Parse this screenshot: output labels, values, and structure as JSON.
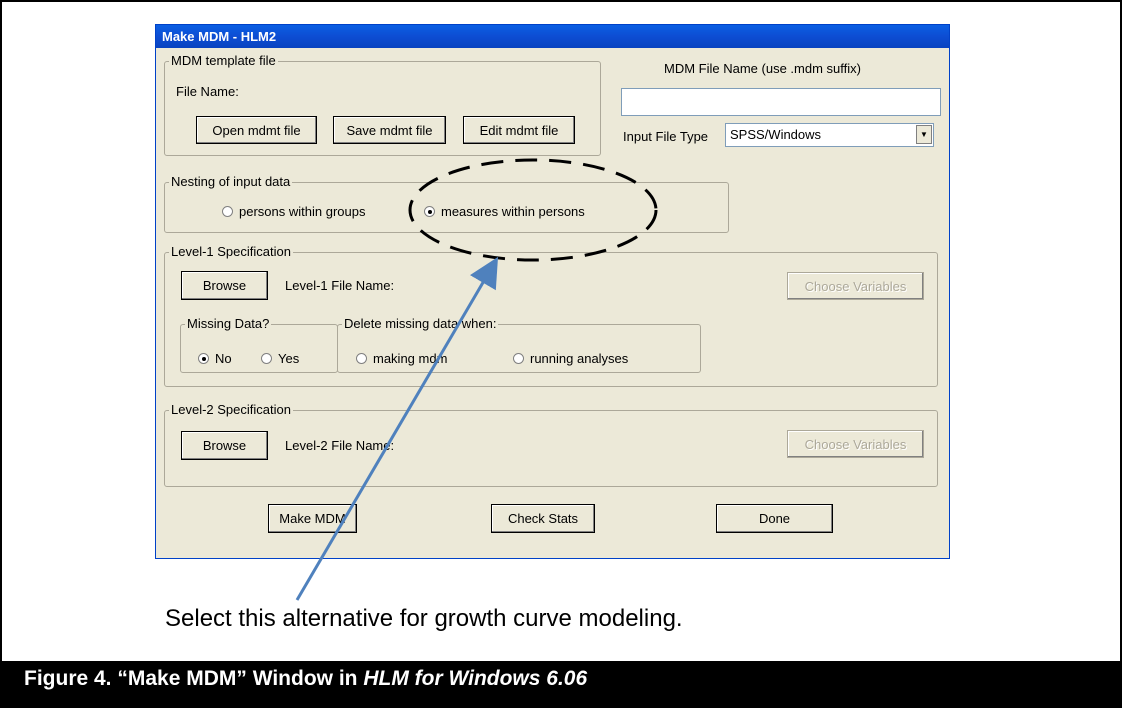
{
  "window": {
    "title": "Make MDM - HLM2"
  },
  "template_group": {
    "legend": "MDM template file",
    "file_name_label": "File Name:",
    "open_button": "Open mdmt file",
    "save_button": "Save mdmt file",
    "edit_button": "Edit mdmt file"
  },
  "mdm_file": {
    "label": "MDM File Name (use .mdm suffix)",
    "value": "",
    "input_type_label": "Input File Type",
    "input_type_value": "SPSS/Windows"
  },
  "nesting": {
    "legend": "Nesting of input data",
    "option1": "persons within groups",
    "option2": "measures within persons",
    "selected": "measures within persons"
  },
  "level1": {
    "legend": "Level-1 Specification",
    "browse": "Browse",
    "file_label": "Level-1 File Name:",
    "choose_vars": "Choose Variables",
    "missing_legend": "Missing Data?",
    "missing_no": "No",
    "missing_yes": "Yes",
    "missing_selected": "No",
    "delete_legend": "Delete missing data when:",
    "delete_opt1": "making mdm",
    "delete_opt2": "running analyses"
  },
  "level2": {
    "legend": "Level-2 Specification",
    "browse": "Browse",
    "file_label": "Level-2 File Name:",
    "choose_vars": "Choose Variables"
  },
  "footer_buttons": {
    "make_mdm": "Make MDM",
    "check_stats": "Check Stats",
    "done": "Done"
  },
  "annotation": {
    "note": "Select this alternative for growth curve modeling.",
    "arrow_color": "#4f81bd",
    "ellipse_color": "#000000"
  },
  "caption": {
    "prefix": "Figure 4. “Make MDM” Window in ",
    "italic": "HLM for Windows 6.06"
  }
}
